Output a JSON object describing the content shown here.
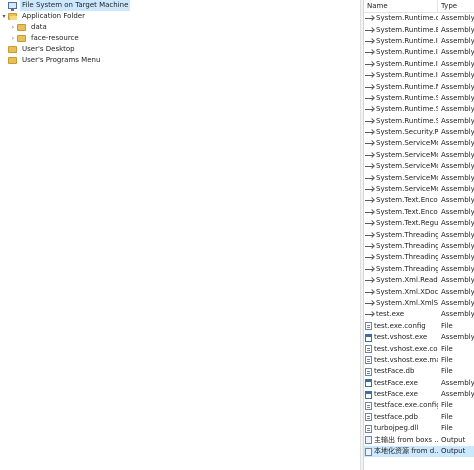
{
  "tree": {
    "items": [
      {
        "label": "File System on Target Machine",
        "icon": "computer-icon",
        "level": 0,
        "toggle": "",
        "selected": true
      },
      {
        "label": "Application Folder",
        "icon": "folder-open-icon",
        "level": 0,
        "toggle": "v"
      },
      {
        "label": "data",
        "icon": "folder-icon",
        "level": 1,
        "toggle": ">"
      },
      {
        "label": "face-resource",
        "icon": "folder-icon",
        "level": 1,
        "toggle": ">"
      },
      {
        "label": "User's Desktop",
        "icon": "folder-icon",
        "level": 0,
        "toggle": ""
      },
      {
        "label": "User's Programs Menu",
        "icon": "folder-icon",
        "level": 0,
        "toggle": ""
      }
    ]
  },
  "list": {
    "columns": {
      "name": "Name",
      "type": "Type"
    },
    "rows": [
      {
        "name": "System.Runtime.dll",
        "type": "Assembly",
        "icon": "reference-icon"
      },
      {
        "name": "System.Runtime.E...",
        "type": "Assembly",
        "icon": "reference-icon"
      },
      {
        "name": "System.Runtime.In...",
        "type": "Assembly",
        "icon": "reference-icon"
      },
      {
        "name": "System.Runtime.In...",
        "type": "Assembly",
        "icon": "reference-icon"
      },
      {
        "name": "System.Runtime.In...",
        "type": "Assembly",
        "icon": "reference-icon"
      },
      {
        "name": "System.Runtime.In...",
        "type": "Assembly",
        "icon": "reference-icon"
      },
      {
        "name": "System.Runtime.N...",
        "type": "Assembly",
        "icon": "reference-icon"
      },
      {
        "name": "System.Runtime.S...",
        "type": "Assembly",
        "icon": "reference-icon"
      },
      {
        "name": "System.Runtime.S...",
        "type": "Assembly",
        "icon": "reference-icon"
      },
      {
        "name": "System.Runtime.S...",
        "type": "Assembly",
        "icon": "reference-icon"
      },
      {
        "name": "System.Security.P...",
        "type": "Assembly",
        "icon": "reference-icon"
      },
      {
        "name": "System.ServiceMo...",
        "type": "Assembly",
        "icon": "reference-icon"
      },
      {
        "name": "System.ServiceMo...",
        "type": "Assembly",
        "icon": "reference-icon"
      },
      {
        "name": "System.ServiceMo...",
        "type": "Assembly",
        "icon": "reference-icon"
      },
      {
        "name": "System.ServiceMo...",
        "type": "Assembly",
        "icon": "reference-icon"
      },
      {
        "name": "System.ServiceMo...",
        "type": "Assembly",
        "icon": "reference-icon"
      },
      {
        "name": "System.Text.Enco...",
        "type": "Assembly",
        "icon": "reference-icon"
      },
      {
        "name": "System.Text.Enco...",
        "type": "Assembly",
        "icon": "reference-icon"
      },
      {
        "name": "System.Text.Regul...",
        "type": "Assembly",
        "icon": "reference-icon"
      },
      {
        "name": "System.Threading...",
        "type": "Assembly",
        "icon": "reference-icon"
      },
      {
        "name": "System.Threading...",
        "type": "Assembly",
        "icon": "reference-icon"
      },
      {
        "name": "System.Threading...",
        "type": "Assembly",
        "icon": "reference-icon"
      },
      {
        "name": "System.Threading...",
        "type": "Assembly",
        "icon": "reference-icon"
      },
      {
        "name": "System.Xml.Read...",
        "type": "Assembly",
        "icon": "reference-icon"
      },
      {
        "name": "System.Xml.XDoc...",
        "type": "Assembly",
        "icon": "reference-icon"
      },
      {
        "name": "System.Xml.XmlSe...",
        "type": "Assembly",
        "icon": "reference-icon"
      },
      {
        "name": "test.exe",
        "type": "Assembly",
        "icon": "reference-icon"
      },
      {
        "name": "test.exe.config",
        "type": "File",
        "icon": "file-icon"
      },
      {
        "name": "test.vshost.exe",
        "type": "Assembly",
        "icon": "application-icon"
      },
      {
        "name": "test.vshost.exe.co...",
        "type": "File",
        "icon": "file-icon"
      },
      {
        "name": "test.vshost.exe.ma...",
        "type": "File",
        "icon": "file-icon"
      },
      {
        "name": "testFace.db",
        "type": "File",
        "icon": "file-icon"
      },
      {
        "name": "testFace.exe",
        "type": "Assembly",
        "icon": "application-icon"
      },
      {
        "name": "testFace.exe",
        "type": "Assembly",
        "icon": "application-icon"
      },
      {
        "name": "testface.exe.config",
        "type": "File",
        "icon": "file-icon"
      },
      {
        "name": "testface.pdb",
        "type": "File",
        "icon": "file-icon"
      },
      {
        "name": "turbojpeg.dll",
        "type": "File",
        "icon": "file-icon"
      },
      {
        "name": "主输出 from boxs ...",
        "type": "Output",
        "icon": "output-icon"
      },
      {
        "name": "本地化资源 from d...",
        "type": "Output",
        "icon": "output-icon",
        "selected": true
      }
    ]
  }
}
